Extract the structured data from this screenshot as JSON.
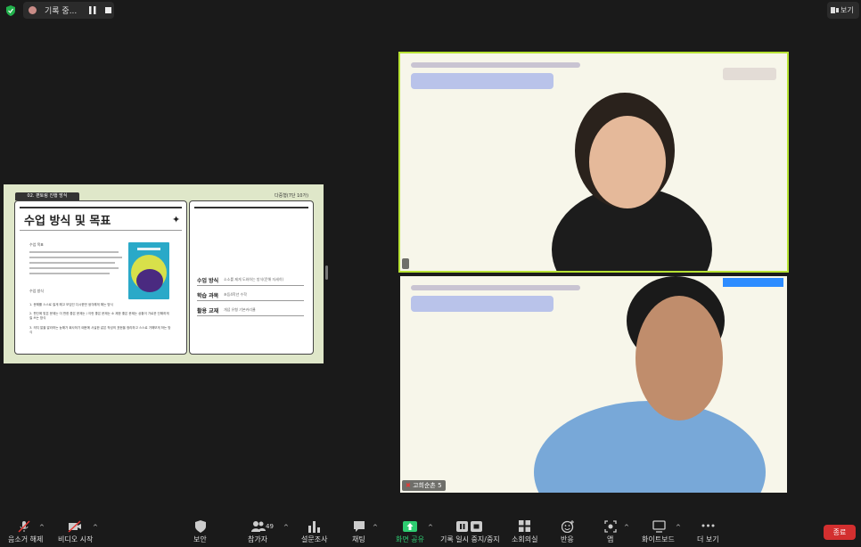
{
  "top": {
    "recording_text": "기록 중...",
    "view_label": "보기"
  },
  "slide": {
    "tab_label": "02. 편토링 진행 방식",
    "tag": "다중형(7단 10가)",
    "title": "수업 방식 및 목표",
    "goal_label": "수업 목표",
    "method_label": "수업 방식",
    "method_items": [
      "1. 문해를 스스로 질게 해고 모임인 다시한번 생각해게 해는 방식",
      "2. 판단에 맞은 문제는 이 판한 좋은 문제는 / 이런 좋은 문제는 소 제한 좋은 문제는 상황이 가로운 단해하게 질 쓰는 방식",
      "3. 의지 말을 말라하는 능해가 회사하기 때문에 사실한 같은 작성의 표현을 정리하고 스스로 거해보게 하는 방식"
    ],
    "info_rows": [
      {
        "key": "수업 방식",
        "value": "소소를 제게 도와하는 방식(문해 자세히)"
      },
      {
        "key": "학습 과목",
        "value": "초등4학년 수학"
      },
      {
        "key": "활용 교재",
        "value": "개념 유형 기본커리큘"
      }
    ]
  },
  "tiles": [
    {
      "name": ""
    },
    {
      "name": "고희순촌 5"
    }
  ],
  "toolbar": {
    "participants_count": "49",
    "items": [
      {
        "id": "mute",
        "label": "음소거 해제"
      },
      {
        "id": "video",
        "label": "비디오 시작"
      },
      {
        "id": "security",
        "label": "보안"
      },
      {
        "id": "participants",
        "label": "참가자"
      },
      {
        "id": "polls",
        "label": "설문조사"
      },
      {
        "id": "chat",
        "label": "채팅"
      },
      {
        "id": "share",
        "label": "화면 공유"
      },
      {
        "id": "pause-record",
        "label": "기록 일시 중지/중지"
      },
      {
        "id": "breakout",
        "label": "소회의실"
      },
      {
        "id": "reactions",
        "label": "반응"
      },
      {
        "id": "apps",
        "label": "앱"
      },
      {
        "id": "whiteboard",
        "label": "화이트보드"
      },
      {
        "id": "more",
        "label": "더 보기"
      }
    ],
    "end_label": "종료"
  },
  "colors": {
    "background": "#1a1a1a",
    "active_speaker_border": "#b7e234",
    "share_green": "#2ecc71",
    "end_red": "#d32f2f"
  }
}
